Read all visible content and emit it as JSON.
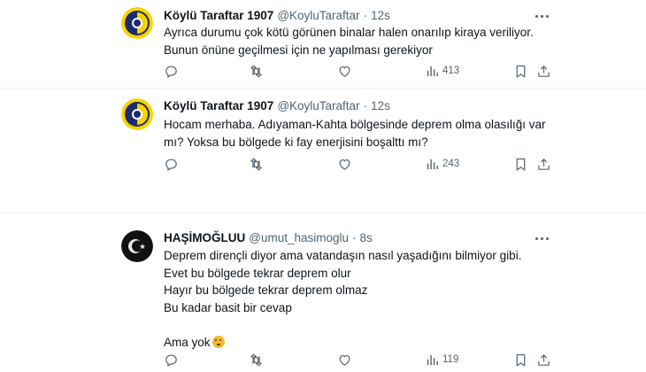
{
  "tweets": [
    {
      "name": "Köylü Taraftar 1907",
      "handle": "@KoyluTaraftar",
      "separator": "·",
      "time": "12s",
      "lines": [
        "Ayrıca durumu çok kötü görünen binalar halen onarılıp kiraya veriliyor.",
        "Bunun önüne geçilmesi için ne yapılması gerekiyor"
      ],
      "views": "413",
      "avatar": "fenerbahce-crest"
    },
    {
      "name": "Köylü Taraftar 1907",
      "handle": "@KoyluTaraftar",
      "separator": "·",
      "time": "12s",
      "lines": [
        "Hocam merhaba. Adıyaman-Kahta bölgesinde deprem olma olasılığı var",
        "mı? Yoksa bu bölgede ki fay enerjisini boşalttı mı?"
      ],
      "views": "243",
      "avatar": "fenerbahce-crest"
    },
    {
      "name": "HAŞİMOĞLUU",
      "handle": "@umut_hasimoglu",
      "separator": "·",
      "time": "8s",
      "lines": [
        "Deprem dirençli diyor ama vatandaşın nasıl yaşadığını bilmiyor gibi.",
        "Evet bu bölgede tekrar deprem olur",
        "Hayır bu bölgede tekrar deprem olmaz",
        "Bu kadar basit bir cevap",
        "",
        "Ama yok"
      ],
      "views": "119",
      "avatar": "crescent-star",
      "emoji": "thinking-face-icon"
    }
  ],
  "icons": {
    "reply": "reply-icon",
    "retweet": "retweet-icon",
    "like": "like-icon",
    "views": "views-icon",
    "bookmark": "bookmark-icon",
    "share": "share-icon",
    "more": "more-icon"
  },
  "colors": {
    "text": "#0f1419",
    "secondary": "#536471",
    "divider": "#eff3f4",
    "fb_navy": "#1a2a6c",
    "fb_yellow": "#f6d304"
  }
}
